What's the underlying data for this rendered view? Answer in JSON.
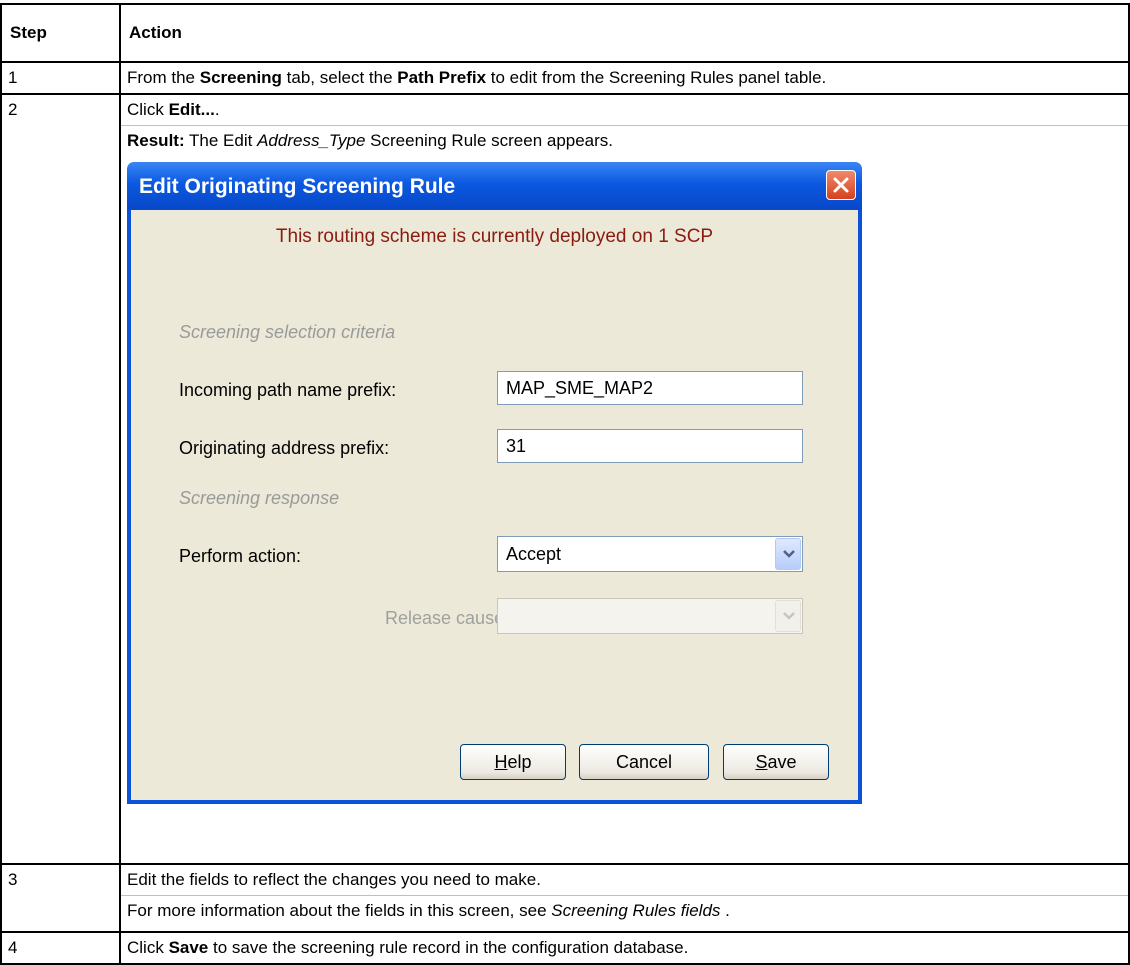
{
  "table": {
    "headers": {
      "step": "Step",
      "action": "Action"
    },
    "rows": [
      {
        "step": "1",
        "parts": [
          "From the ",
          "Screening",
          " tab, select the ",
          "Path Prefix",
          " to edit from the Screening Rules panel table."
        ]
      },
      {
        "step": "2",
        "click_prefix": "Click ",
        "click_bold": "Edit...",
        "click_suffix": ".",
        "result_label": "Result:",
        "result_pre": " The Edit ",
        "result_italic": "Address_Type",
        "result_post": " Screening Rule screen appears."
      },
      {
        "step": "3",
        "line1": "Edit the fields to reflect the changes you need to make.",
        "line2_pre": "For more information about the fields in this screen, see ",
        "line2_italic": "Screening Rules fields",
        "line2_post": " ."
      },
      {
        "step": "4",
        "pre": "Click ",
        "bold": "Save",
        "post": " to save the screening rule record in the configuration database."
      }
    ]
  },
  "dialog": {
    "title": "Edit Originating Screening Rule",
    "notice": "This routing scheme is currently deployed on 1 SCP",
    "section_criteria": "Screening selection criteria",
    "incoming_label": "Incoming path name prefix:",
    "incoming_value": "MAP_SME_MAP2",
    "originating_label": "Originating address prefix:",
    "originating_value": "31",
    "section_response": "Screening response",
    "action_label": "Perform action:",
    "action_value": "Accept",
    "release_label": "Release cause:",
    "release_value": "",
    "buttons": {
      "help_mnemonic": "H",
      "help_rest": "elp",
      "cancel": "Cancel",
      "save_mnemonic": "S",
      "save_rest": "ave"
    }
  },
  "colors": {
    "titlebar": "#0a52d8",
    "client": "#ece9d8",
    "notice": "#8b1a10",
    "section": "#9a9a9a",
    "close_button": "#d5401e"
  }
}
